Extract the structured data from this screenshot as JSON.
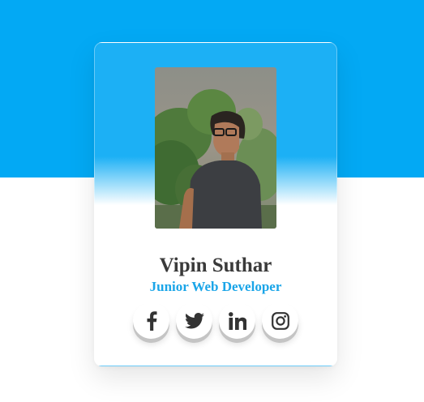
{
  "profile": {
    "name": "Vipin Suthar",
    "role": "Junior Web Developer"
  },
  "socials": [
    {
      "icon": "facebook-icon"
    },
    {
      "icon": "twitter-icon"
    },
    {
      "icon": "linkedin-icon"
    },
    {
      "icon": "instagram-icon"
    }
  ],
  "colors": {
    "background_top": "#03a9f4",
    "background_bottom": "#ffffff",
    "card_top": "#1cb0f5",
    "name_text": "#3a3a3a",
    "role_text": "#1aa5e8",
    "icon": "#333333"
  }
}
